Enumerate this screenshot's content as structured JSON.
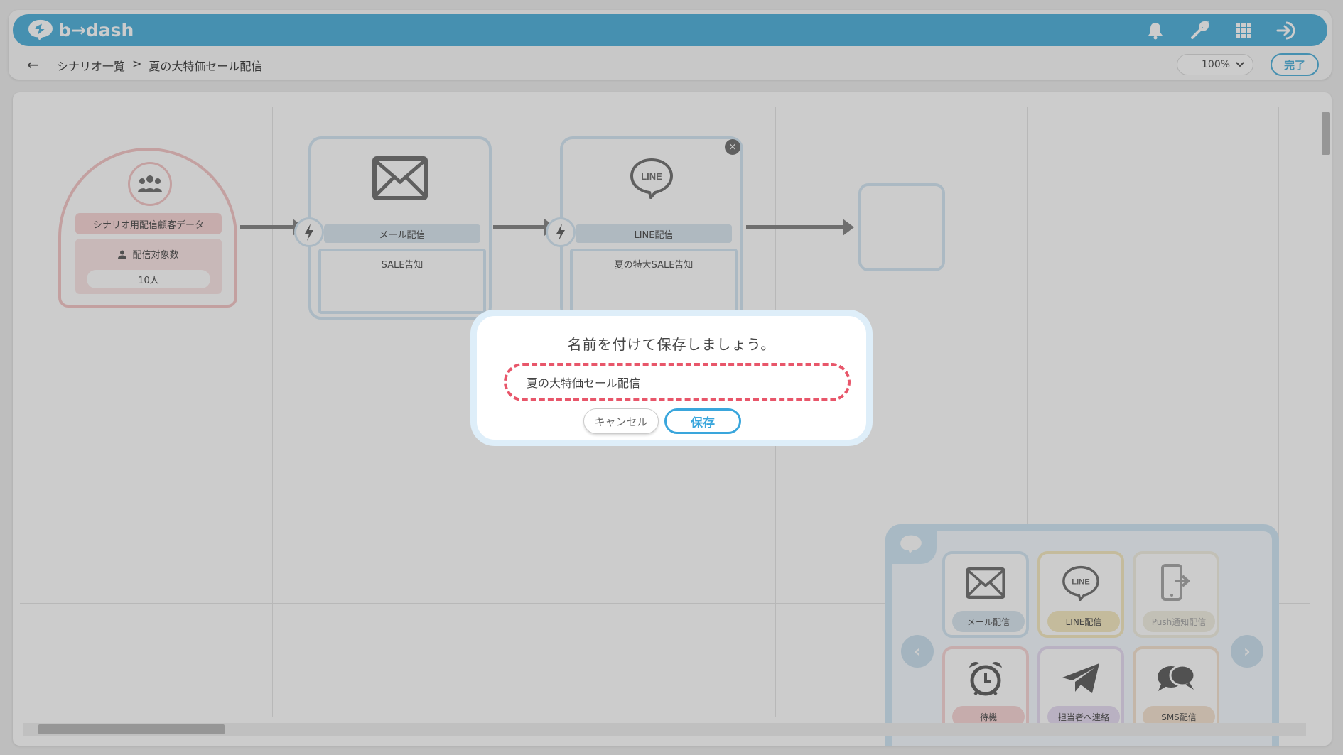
{
  "header": {
    "logo_text": "b→dash",
    "icons": [
      "bell-icon",
      "wrench-icon",
      "grid-apps-icon",
      "logout-icon"
    ]
  },
  "breadcrumb": {
    "back": "←",
    "parent": "シナリオ一覧",
    "separator": ">",
    "current": "夏の大特価セール配信"
  },
  "toolbar": {
    "zoom": "100%",
    "done_label": "完了"
  },
  "canvas": {
    "segment": {
      "title": "シナリオ用配信顧客データ",
      "count_label": "配信対象数",
      "count_value": "10人"
    },
    "actions": [
      {
        "label": "メール配信",
        "content": "SALE告知"
      },
      {
        "label": "LINE配信",
        "content": "夏の特大SALE告知"
      }
    ]
  },
  "palette": {
    "items": [
      {
        "label": "メール配信",
        "color": "#dbe8f1"
      },
      {
        "label": "LINE配信",
        "color": "#f6eac4"
      },
      {
        "label": "Push通知配信",
        "color": "#f3f0e4"
      },
      {
        "label": "待機",
        "color": "#f8d8d8"
      },
      {
        "label": "担当者へ連絡",
        "color": "#e8def3"
      },
      {
        "label": "SMS配信",
        "color": "#f6e4d2"
      }
    ],
    "prev": "‹",
    "next": "›"
  },
  "dialog": {
    "title": "名前を付けて保存しましょう。",
    "input_value": "夏の大特価セール配信",
    "cancel_label": "キャンセル",
    "save_label": "保存"
  },
  "colors": {
    "accent": "#3aa6dc",
    "header": "#58b4dc",
    "highlight": "#e8566a"
  }
}
